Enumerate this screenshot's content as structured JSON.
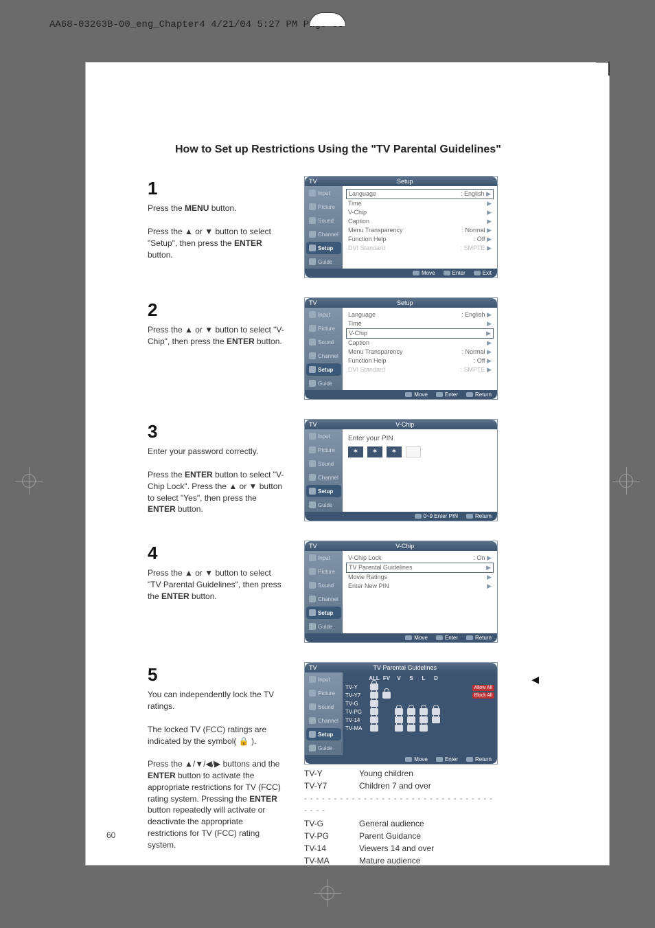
{
  "header_line": "AA68-03263B-00_eng_Chapter4  4/21/04  5:27 PM  Page 60",
  "page_title": "How to Set up Restrictions Using the \"TV Parental Guidelines\"",
  "page_number": "60",
  "side_marker": "◀",
  "steps": {
    "s1": {
      "num": "1",
      "p1a": "Press the ",
      "p1b": "MENU",
      "p1c": " button.",
      "p2": "Press the ▲ or ▼ button to select \"Setup\", then press the ",
      "p2b": "ENTER",
      "p2c": " button."
    },
    "s2": {
      "num": "2",
      "p1": "Press the ▲ or ▼ button to select \"V-Chip\", then press the ",
      "p1b": "ENTER",
      "p1c": " button."
    },
    "s3": {
      "num": "3",
      "p1": "Enter your password correctly.",
      "p2a": "Press the ",
      "p2b": "ENTER",
      "p2c": " button to select \"V-Chip Lock\". Press the ▲ or ▼ button to select \"Yes\", then press the ",
      "p2d": "ENTER",
      "p2e": " button."
    },
    "s4": {
      "num": "4",
      "p1": "Press the ▲ or ▼ button to select \"TV Parental Guidelines\", then press the ",
      "p1b": "ENTER",
      "p1c": " button."
    },
    "s5": {
      "num": "5",
      "p1": "You can independently lock the TV ratings.",
      "p2": "The locked TV (FCC) ratings are indicated by the symbol( 🔒 ).",
      "p3a": "Press the ▲/▼/◀/▶ buttons and the ",
      "p3b": "ENTER",
      "p3c": " button to activate the appropriate restrictions for TV (FCC) rating system. Pressing the ",
      "p3d": "ENTER",
      "p3e": " button repeatedly will activate or deactivate the appropriate restrictions for TV (FCC) rating system."
    }
  },
  "osd": {
    "tv_label": "TV",
    "setup_title": "Setup",
    "vchip_title": "V-Chip",
    "guidelines_title": "TV Parental Guidelines",
    "tabs": [
      "Input",
      "Picture",
      "Sound",
      "Channel",
      "Setup",
      "Guide"
    ],
    "setup_items": [
      {
        "k": "Language",
        "v": ": English"
      },
      {
        "k": "Time",
        "v": ""
      },
      {
        "k": "V-Chip",
        "v": ""
      },
      {
        "k": "Caption",
        "v": ""
      },
      {
        "k": "Menu Transparency",
        "v": ": Normal"
      },
      {
        "k": "Function Help",
        "v": ": Off"
      },
      {
        "k": "DVI Standard",
        "v": ": SMPTE"
      }
    ],
    "vchip_items": [
      {
        "k": "V-Chip Lock",
        "v": ": On"
      },
      {
        "k": "TV Parental Guidelines",
        "v": ""
      },
      {
        "k": "Movie Ratings",
        "v": ""
      },
      {
        "k": "Enter New PIN",
        "v": ""
      }
    ],
    "footer": {
      "move": "Move",
      "enter": "Enter",
      "exit": "Exit",
      "return": "Return"
    },
    "pin_label": "Enter your PIN",
    "pin_footer": "0~9 Enter PIN",
    "gg_head": [
      "",
      "ALL",
      "FV",
      "V",
      "S",
      "L",
      "D"
    ],
    "gg_rows": [
      "TV-Y",
      "TV-Y7",
      "TV-G",
      "TV-PG",
      "TV-14",
      "TV-MA"
    ],
    "allow_all": "Allow All",
    "block_all": "Block All"
  },
  "legend": {
    "tvy": {
      "code": "TV-Y",
      "desc": "Young children"
    },
    "tvy7": {
      "code": "TV-Y7",
      "desc": "Children 7 and over"
    },
    "sep": "- - - - - - - - - - - - - - - - - - - - - - - - - - - - - - - - - - - -",
    "tvg": {
      "code": "TV-G",
      "desc": "General audience"
    },
    "tvpg": {
      "code": "TV-PG",
      "desc": "Parent Guidance"
    },
    "tv14": {
      "code": "TV-14",
      "desc": "Viewers 14 and over"
    },
    "tvma": {
      "code": "TV-MA",
      "desc": "Mature audience"
    }
  }
}
